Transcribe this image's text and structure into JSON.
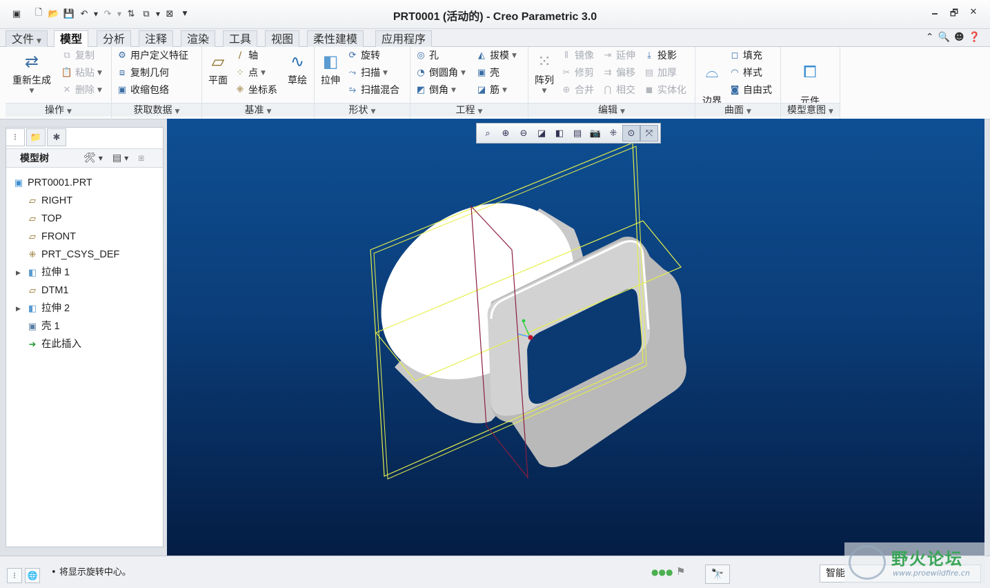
{
  "window": {
    "title": "PRT0001 (活动的) - Creo Parametric 3.0",
    "controls": [
      "🗕",
      "🗗",
      "✕"
    ]
  },
  "quick_access": [
    "new-icon",
    "open-icon",
    "save-icon",
    "undo-icon",
    "redo-icon",
    "regenerate-icon",
    "windows-icon",
    "close-window-icon"
  ],
  "tabs": {
    "file": "文件",
    "items": [
      "模型",
      "分析",
      "注释",
      "渲染",
      "工具",
      "视图",
      "柔性建模",
      "应用程序"
    ],
    "active": "模型"
  },
  "ribbon": {
    "operations": {
      "label": "操作",
      "regenerate": "重新生成",
      "copy": "复制",
      "paste": "粘贴",
      "delete": "删除"
    },
    "get_data": {
      "label": "获取数据",
      "udf": "用户定义特征",
      "copy_geom": "复制几何",
      "shrinkwrap": "收缩包络"
    },
    "datum": {
      "label": "基准",
      "plane": "平面",
      "axis": "轴",
      "point": "点",
      "csys": "坐标系",
      "sketch": "草绘"
    },
    "shapes": {
      "label": "形状",
      "extrude": "拉伸",
      "revolve": "旋转",
      "sweep": "扫描",
      "swept_blend": "扫描混合"
    },
    "engineering": {
      "label": "工程",
      "hole": "孔",
      "round": "倒圆角",
      "chamfer": "倒角",
      "draft": "拔模",
      "shell": "壳",
      "rib": "筋"
    },
    "editing": {
      "label": "编辑",
      "pattern": "阵列",
      "mirror": "镜像",
      "trim": "修剪",
      "merge": "合并",
      "extend": "延伸",
      "offset": "偏移",
      "intersect": "相交",
      "project": "投影",
      "thicken": "加厚",
      "solidify": "实体化"
    },
    "surfaces": {
      "label": "曲面",
      "boundary_blend": "边界\n混合",
      "fill": "填充",
      "style": "样式",
      "freestyle": "自由式"
    },
    "model_intent": {
      "label": "模型意图",
      "component_interface": "元件\n界面"
    }
  },
  "model_tree": {
    "title": "模型树",
    "nodes": [
      {
        "label": "PRT0001.PRT",
        "icon": "part-icon",
        "expandable": false,
        "level": 0
      },
      {
        "label": "RIGHT",
        "icon": "datum-plane-icon",
        "expandable": false,
        "level": 1
      },
      {
        "label": "TOP",
        "icon": "datum-plane-icon",
        "expandable": false,
        "level": 1
      },
      {
        "label": "FRONT",
        "icon": "datum-plane-icon",
        "expandable": false,
        "level": 1
      },
      {
        "label": "PRT_CSYS_DEF",
        "icon": "csys-icon",
        "expandable": false,
        "level": 1
      },
      {
        "label": "拉伸 1",
        "icon": "extrude-icon",
        "expandable": true,
        "level": 1
      },
      {
        "label": "DTM1",
        "icon": "datum-plane-icon",
        "expandable": false,
        "level": 1
      },
      {
        "label": "拉伸 2",
        "icon": "extrude-icon",
        "expandable": true,
        "level": 1
      },
      {
        "label": "壳 1",
        "icon": "shell-icon",
        "expandable": false,
        "level": 1
      },
      {
        "label": "在此插入",
        "icon": "insert-here-icon",
        "expandable": false,
        "level": 1
      }
    ]
  },
  "view_toolbar": [
    "refit-icon",
    "zoom-in-icon",
    "zoom-out-icon",
    "repaint-icon",
    "display-style-icon",
    "saved-orientations-icon",
    "view-manager-icon",
    "datum-display-icon",
    "spin-center-icon",
    "annotation-display-icon"
  ],
  "status": {
    "message": "将显示旋转中心。",
    "filter": "智能"
  },
  "watermark": {
    "text": "野火论坛",
    "url": "www.proewildfire.cn"
  },
  "colors": {
    "viewport_top": "#0e4f93",
    "viewport_bottom": "#041d44",
    "datum_plane": "#e6f04a",
    "datum_edge": "#8b1d3f"
  }
}
